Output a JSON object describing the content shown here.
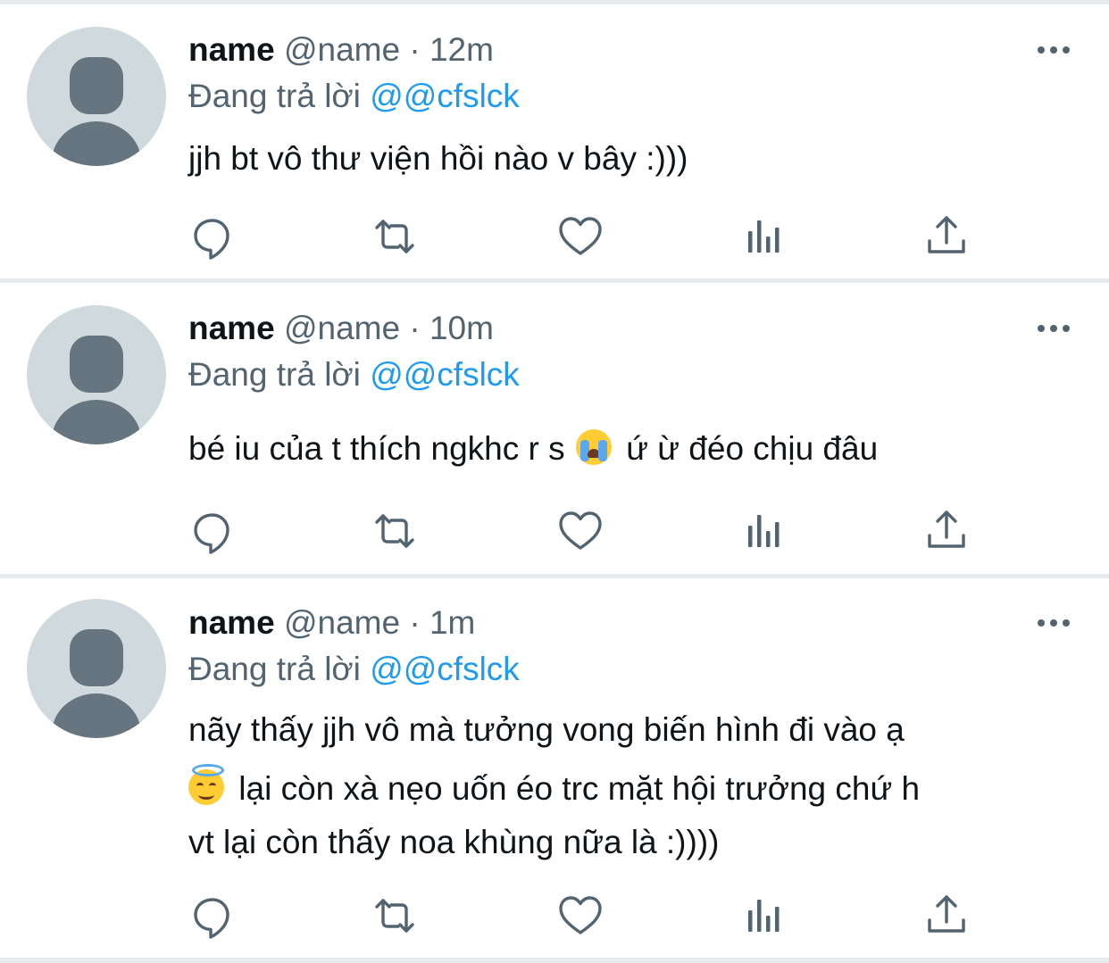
{
  "tweets": [
    {
      "name": "name",
      "handle": "@name",
      "time": "· 12m",
      "reply_prefix": "Đang trả lời",
      "reply_to": "@@cfslck",
      "lines": [
        "jjh bt vô thư viện hồi nào v bây :)))"
      ]
    },
    {
      "name": "name",
      "handle": "@name",
      "time": "· 10m",
      "reply_prefix": "Đang trả lời",
      "reply_to": "@@cfslck",
      "text_before_emoji": "bé iu của t thích ngkhc r s",
      "emoji": "loudly-crying-face-emoji",
      "text_after_emoji": " ứ ừ đéo chịu đâu"
    },
    {
      "name": "name",
      "handle": "@name",
      "time": "· 1m",
      "reply_prefix": "Đang trả lời",
      "reply_to": "@@cfslck",
      "line1": "nãy thấy jjh vô mà tưởng vong biến hình đi vào ạ",
      "emoji": "smiling-face-with-halo-emoji",
      "line2": "lại còn xà nẹo uốn éo trc mặt hội trưởng chứ h",
      "line3": "vt lại còn thấy noa khùng nữa là :))))"
    }
  ],
  "actions": [
    "reply-icon",
    "retweet-icon",
    "like-icon",
    "analytics-icon",
    "share-icon"
  ],
  "colors": {
    "text": "#0f1419",
    "secondary": "#536471",
    "link": "#1d9bf0",
    "separator": "#e8ebee",
    "avatar_bg": "#cfd9de",
    "avatar_fg": "#66757f"
  }
}
